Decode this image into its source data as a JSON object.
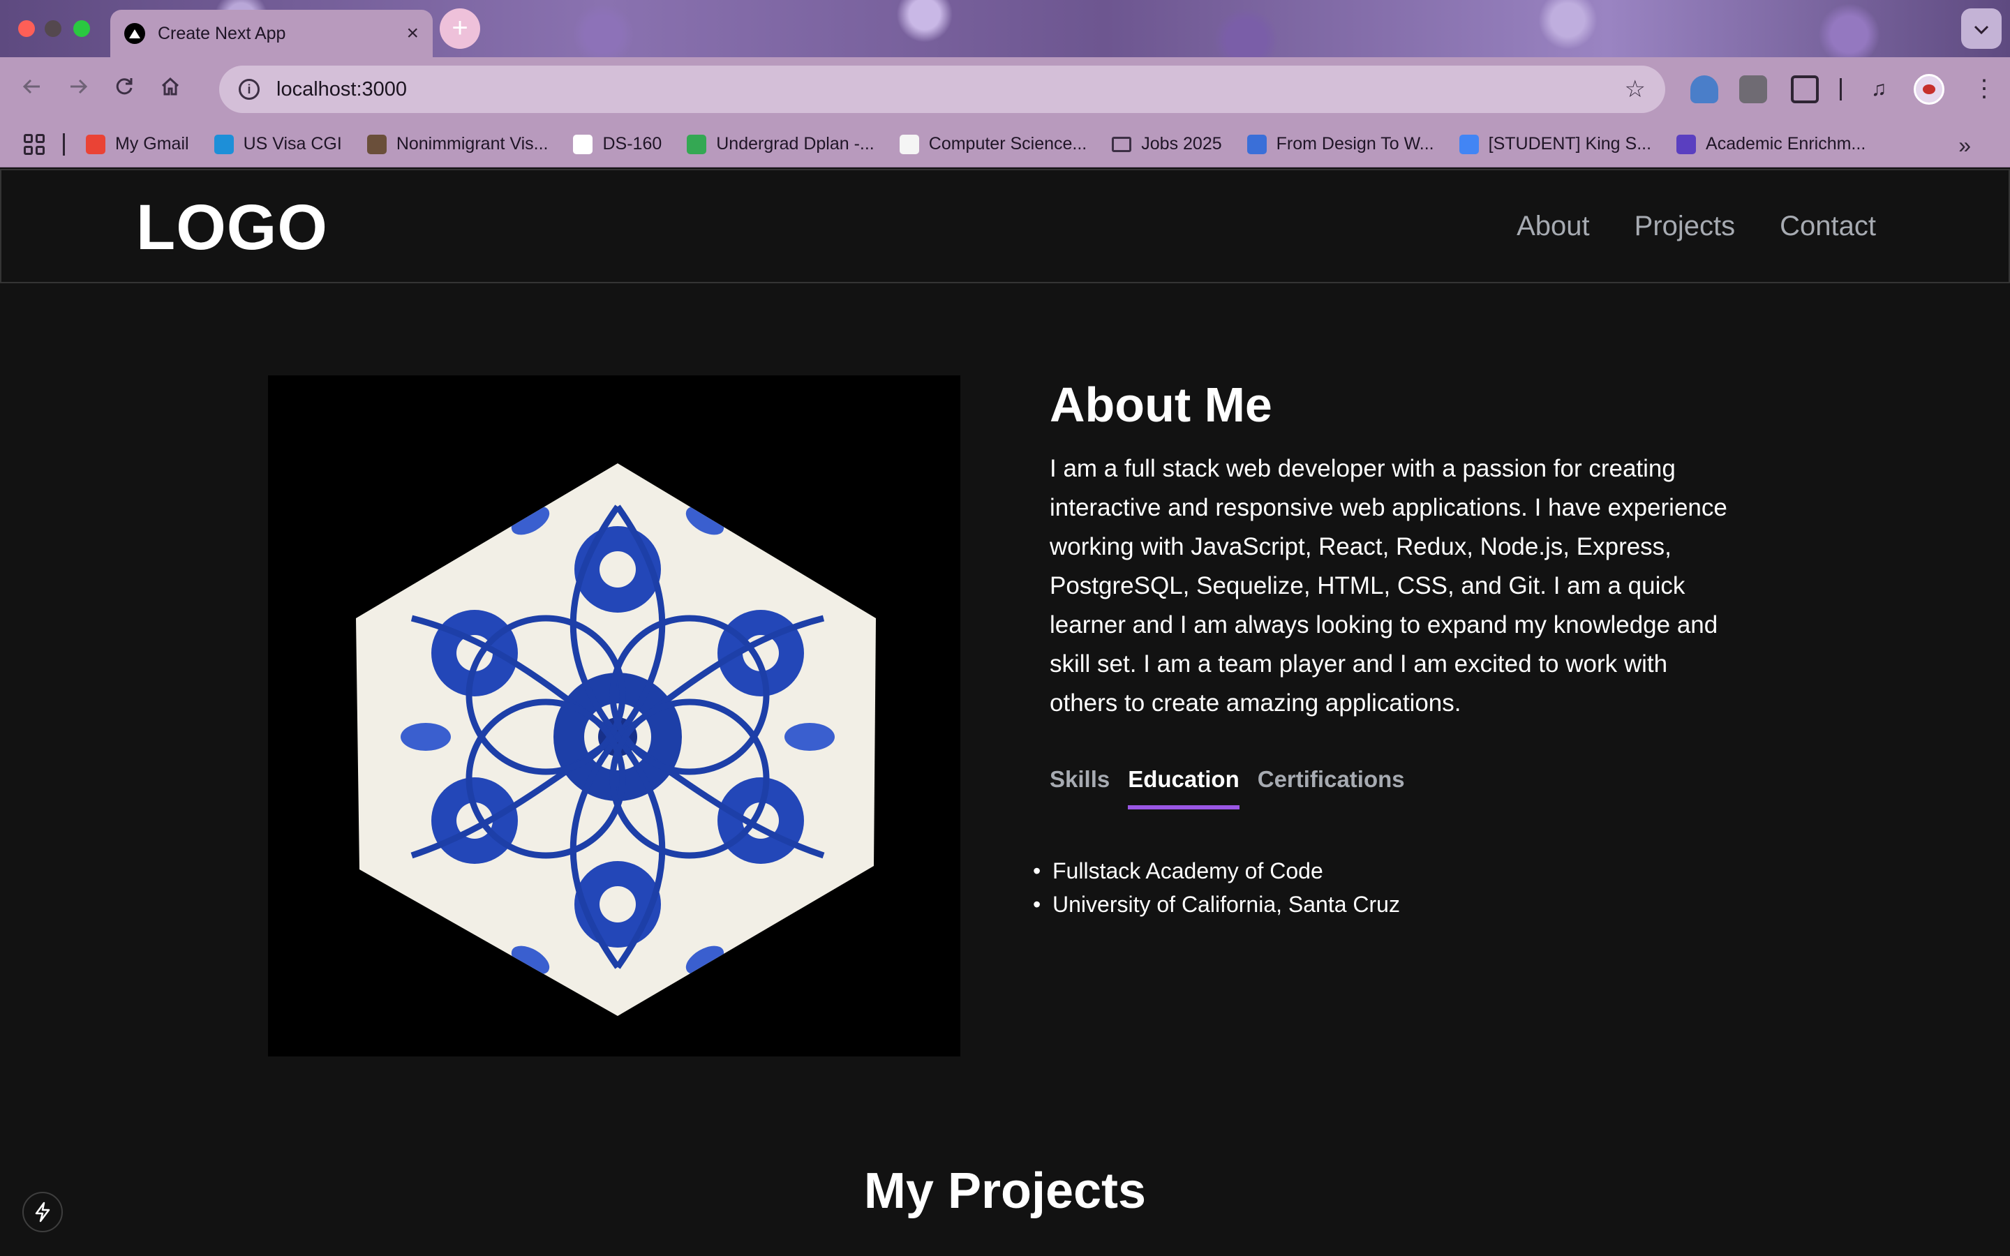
{
  "browser": {
    "tab_title": "Create Next App",
    "tab_close": "×",
    "new_tab": "+",
    "url": "localhost:3000",
    "bookmarks": [
      {
        "label": "My Gmail",
        "icon": "gmail-icon",
        "color": "#ea4335"
      },
      {
        "label": "US Visa CGI",
        "icon": "cloud-icon",
        "color": "#1d8fd8"
      },
      {
        "label": "Nonimmigrant Vis...",
        "icon": "flag-icon",
        "color": "#6a4f3a"
      },
      {
        "label": "DS-160",
        "icon": "seal-icon",
        "color": "#ffffff"
      },
      {
        "label": "Undergrad Dplan -...",
        "icon": "sheets-icon",
        "color": "#34a853"
      },
      {
        "label": "Computer Science...",
        "icon": "doc-icon",
        "color": "#f5f5f5"
      },
      {
        "label": "Jobs 2025",
        "icon": "folder-icon",
        "color": "transparent"
      },
      {
        "label": "From Design To W...",
        "icon": "globe-icon",
        "color": "#3a6fd8"
      },
      {
        "label": "[STUDENT] King S...",
        "icon": "docs-icon",
        "color": "#4285f4"
      },
      {
        "label": "Academic Enrichm...",
        "icon": "list-icon",
        "color": "#5a3fc0"
      }
    ]
  },
  "site": {
    "logo": "LOGO",
    "nav": [
      "About",
      "Projects",
      "Contact"
    ]
  },
  "about": {
    "title": "About Me",
    "description": "I am a full stack web developer with a passion for creating interactive and responsive web applications. I have experience working with JavaScript, React, Redux, Node.js, Express, PostgreSQL, Sequelize, HTML, CSS, and Git. I am a quick learner and I am always looking to expand my knowledge and skill set. I am a team player and I am excited to work with others to create amazing applications.",
    "tabs": [
      "Skills",
      "Education",
      "Certifications"
    ],
    "active_tab": "Education",
    "education": [
      "Fullstack Academy of Code",
      "University of California, Santa Cruz"
    ],
    "image_alt": "blue and white hexagonal tile"
  },
  "projects": {
    "title": "My Projects"
  },
  "colors": {
    "page_bg": "#121212",
    "accent": "#9a57e4",
    "muted_text": "#a7abb2",
    "tile_blue": "#1d3fa8"
  }
}
